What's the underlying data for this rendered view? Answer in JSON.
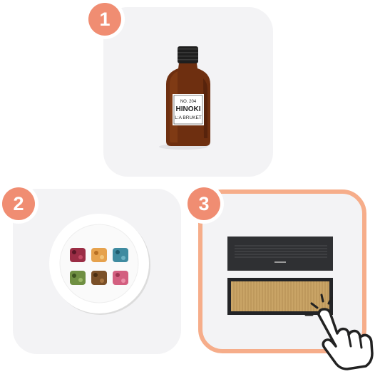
{
  "steps": [
    {
      "number": "1",
      "label": {
        "line1": "NO. 204",
        "line2": "HINOKI",
        "line3": "L:A BRUKET"
      }
    },
    {
      "number": "2"
    },
    {
      "number": "3"
    }
  ],
  "colors": {
    "badge": "#f08d72",
    "card_background": "#f3f3f5",
    "selected_border": "#f6ad8a"
  },
  "icons": {
    "cursor": "pointing-hand-click-icon"
  }
}
